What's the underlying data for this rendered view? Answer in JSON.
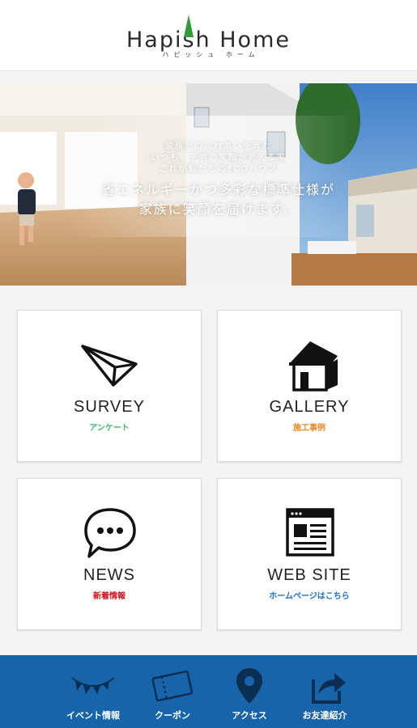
{
  "header": {
    "logo_text": "Hapish Home",
    "logo_subtext": "ハピッシュ ホーム"
  },
  "hero": {
    "tagline_line1": "家族とのふれあいを育む",
    "tagline_line2": "いつも、子供の笑顔が見える家",
    "tagline_line3": "これが私たちのECOハウス",
    "headline_line1": "省エネルギーかつ多彩な標準仕様が",
    "headline_line2": "家族に笑顔を届けます。"
  },
  "tiles": [
    {
      "title": "SURVEY",
      "subtitle": "アンケート",
      "icon": "paper-plane-icon",
      "color": "#3cb878"
    },
    {
      "title": "GALLERY",
      "subtitle": "施工事例",
      "icon": "house-icon",
      "color": "#f0861e"
    },
    {
      "title": "NEWS",
      "subtitle": "新着情報",
      "icon": "speech-bubble-icon",
      "color": "#d0121b"
    },
    {
      "title": "WEB SITE",
      "subtitle": "ホームページはこちら",
      "icon": "browser-window-icon",
      "color": "#1f6fc0"
    }
  ],
  "bottom_nav": {
    "background": "#1864ab",
    "items": [
      {
        "label": "イベント情報",
        "icon": "bunting-icon"
      },
      {
        "label": "クーポン",
        "icon": "coupon-icon"
      },
      {
        "label": "アクセス",
        "icon": "map-pin-icon"
      },
      {
        "label": "お友達紹介",
        "icon": "share-icon"
      }
    ]
  }
}
